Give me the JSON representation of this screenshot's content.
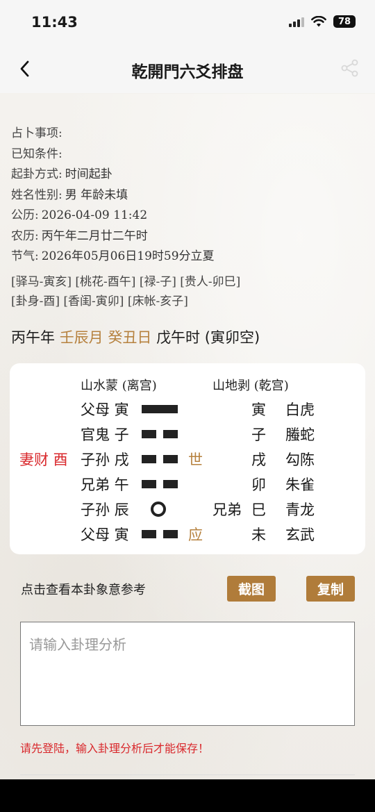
{
  "status": {
    "time": "11:43",
    "battery": "78"
  },
  "nav": {
    "title": "乾開門六爻排盘"
  },
  "info": [
    {
      "label": "占卜事项:",
      "value": ""
    },
    {
      "label": "已知条件:",
      "value": ""
    },
    {
      "label": "起卦方式:",
      "value": "时间起卦"
    },
    {
      "label": "姓名性别:",
      "value": "男 年龄未填"
    },
    {
      "label": "公历:",
      "value": "2026-04-09 11:42"
    },
    {
      "label": "农历:",
      "value": "丙午年二月廿二午时"
    },
    {
      "label": "节气:",
      "value": "2026年05月06日19时59分立夏"
    }
  ],
  "tags": {
    "row1": "[驿马-寅亥] [桃花-酉午] [禄-子] [贵人-卯巳]",
    "row2": "[卦身-酉] [香闺-寅卯] [床帐-亥子]"
  },
  "ganzhi": {
    "year": "丙午年",
    "month": "壬辰月",
    "day": "癸丑日",
    "hour": "戊午时",
    "void": "(寅卯空)"
  },
  "hexagram": {
    "main_title": "山水蒙 (离宫)",
    "changed_title": "山地剥 (乾宫)",
    "rows": [
      {
        "hidden": "",
        "relation": "父母 寅",
        "line": "yang",
        "marker": "",
        "changed_relation": "",
        "changed_branch": "寅",
        "spirit": "白虎"
      },
      {
        "hidden": "",
        "relation": "官鬼 子",
        "line": "yin",
        "marker": "",
        "changed_relation": "",
        "changed_branch": "子",
        "spirit": "螣蛇"
      },
      {
        "hidden": "妻财 酉",
        "relation": "子孙 戌",
        "line": "yin",
        "marker": "世",
        "changed_relation": "",
        "changed_branch": "戌",
        "spirit": "勾陈"
      },
      {
        "hidden": "",
        "relation": "兄弟 午",
        "line": "yin",
        "marker": "",
        "changed_relation": "",
        "changed_branch": "卯",
        "spirit": "朱雀"
      },
      {
        "hidden": "",
        "relation": "子孙 辰",
        "line": "moving",
        "marker": "",
        "changed_relation": "兄弟",
        "changed_branch": "巳",
        "spirit": "青龙"
      },
      {
        "hidden": "",
        "relation": "父母 寅",
        "line": "yin",
        "marker": "应",
        "changed_relation": "",
        "changed_branch": "未",
        "spirit": "玄武"
      }
    ]
  },
  "actions": {
    "reference": "点击查看本卦象意参考",
    "screenshot": "截图",
    "copy": "复制"
  },
  "analysis": {
    "placeholder": "请输入卦理分析",
    "warning": "请先登陆，输入卦理分析后才能保存！"
  },
  "colors": {
    "accent": "#b07c3a",
    "warning": "#d9282c"
  }
}
